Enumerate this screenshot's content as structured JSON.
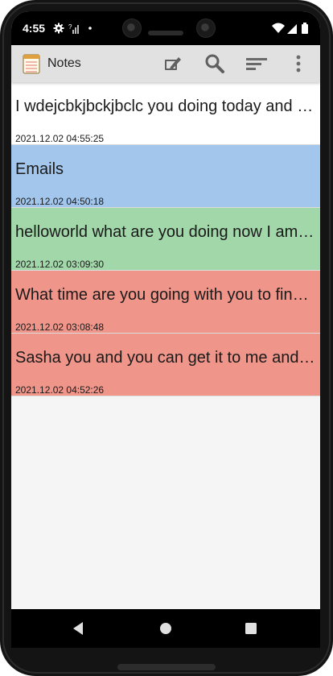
{
  "status_bar": {
    "time": "4:55",
    "icons_left": [
      "gear-icon",
      "no-sim-icon",
      "dot-icon"
    ],
    "icons_right": [
      "wifi-icon",
      "signal-icon",
      "battery-icon"
    ]
  },
  "app_bar": {
    "title": "Notes",
    "actions": [
      "new-note-icon",
      "search-icon",
      "sort-icon",
      "more-options-icon"
    ]
  },
  "notes": [
    {
      "title": "I wdejcbkjbckjbclc you doing today and now",
      "date": "2021.12.02 04:55:25",
      "color": "#ffffff"
    },
    {
      "title": "Emails",
      "date": "2021.12.02 04:50:18",
      "color": "#a3c6ec"
    },
    {
      "title": "helloworld what are you doing now I am going",
      "date": "2021.12.02 03:09:30",
      "color": "#a2d7a9"
    },
    {
      "title": "What time are you going with you to find out",
      "date": "2021.12.02 03:08:48",
      "color": "#f0958a"
    },
    {
      "title": "Sasha you and you can get it to me and you",
      "date": "2021.12.02 04:52:26",
      "color": "#f0958a"
    }
  ],
  "nav_bar": {
    "buttons": [
      "back-icon",
      "home-icon",
      "recents-icon"
    ]
  }
}
